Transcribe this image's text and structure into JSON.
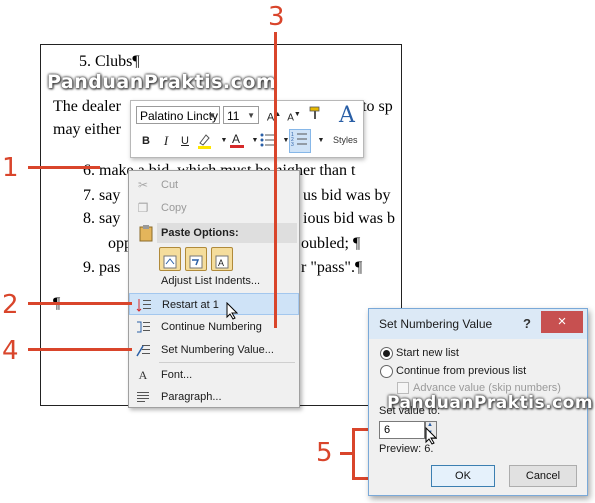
{
  "colors": {
    "callout": "#d9452b",
    "highlight": "#cfe3f7",
    "dialog_border": "#7aa9d8",
    "close_button": "#c75050"
  },
  "watermark": "PanduanPraktis.com",
  "document": {
    "lines": [
      {
        "text": "5.   Clubs¶"
      },
      {
        "text": "The dealer"
      },
      {
        "text": "a to sp"
      },
      {
        "text": "may either"
      },
      {
        "text": "6.   make a bid, which must be higher than t"
      },
      {
        "text": "7.   say"
      },
      {
        "text": "us bid was by"
      },
      {
        "text": "8.   say"
      },
      {
        "text": "ious bid was b"
      },
      {
        "text": "opp"
      },
      {
        "text": "oubled; ¶"
      },
      {
        "text": "9.   pas"
      },
      {
        "text": "r \"pass\".¶"
      },
      {
        "text": "¶"
      }
    ]
  },
  "mini_toolbar": {
    "font_name": "Palatino Lincty",
    "font_size": "11",
    "bold": "B",
    "italic": "I",
    "underline": "U",
    "styles_label": "Styles"
  },
  "context_menu": {
    "cut": "Cut",
    "copy": "Copy",
    "paste_options": "Paste Options:",
    "adjust_list_indents": "Adjust List Indents...",
    "restart_at_1": "Restart at 1",
    "continue_numbering": "Continue Numbering",
    "set_numbering_value": "Set Numbering Value...",
    "font": "Font...",
    "paragraph": "Paragraph..."
  },
  "callouts": {
    "c1": "1",
    "c2": "2",
    "c3": "3",
    "c4": "4",
    "c5": "5"
  },
  "dialog": {
    "title": "Set Numbering Value",
    "help": "?",
    "close": "×",
    "start_new_list": "Start new list",
    "continue_previous": "Continue from previous list",
    "advance_value": "Advance value (skip numbers)",
    "set_value_label": "Set value to:",
    "value": "6",
    "preview": "Preview: 6.",
    "ok": "OK",
    "cancel": "Cancel"
  }
}
